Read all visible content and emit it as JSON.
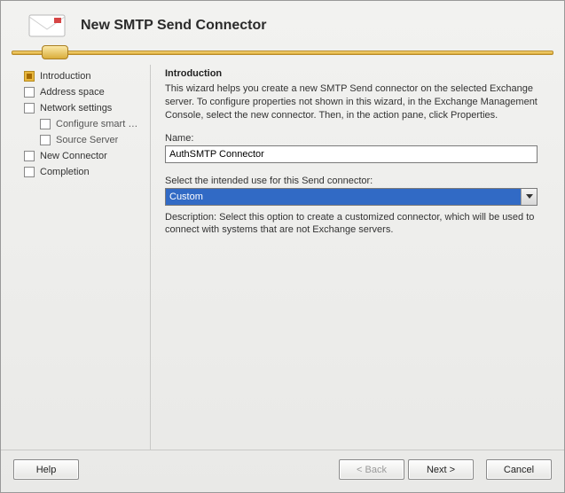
{
  "header": {
    "title": "New SMTP Send Connector"
  },
  "sidebar": {
    "items": [
      {
        "label": "Introduction",
        "current": true
      },
      {
        "label": "Address space"
      },
      {
        "label": "Network settings"
      },
      {
        "label": "Configure smart host authenticatio...",
        "sub": true
      },
      {
        "label": "Source Server",
        "sub": true
      },
      {
        "label": "New Connector"
      },
      {
        "label": "Completion"
      }
    ]
  },
  "content": {
    "heading": "Introduction",
    "intro_text": "This wizard helps you create a new SMTP Send connector on the selected Exchange server. To configure properties not shown in this wizard, in the Exchange Management Console, select the new connector. Then, in the action pane, click Properties.",
    "name_label": "Name:",
    "name_value": "AuthSMTP Connector",
    "use_label": "Select the intended use for this Send connector:",
    "use_value": "Custom",
    "description": "Description: Select this option to create a customized connector, which will be used to connect with systems that are not Exchange servers."
  },
  "footer": {
    "help": "Help",
    "back": "< Back",
    "next": "Next >",
    "cancel": "Cancel"
  }
}
